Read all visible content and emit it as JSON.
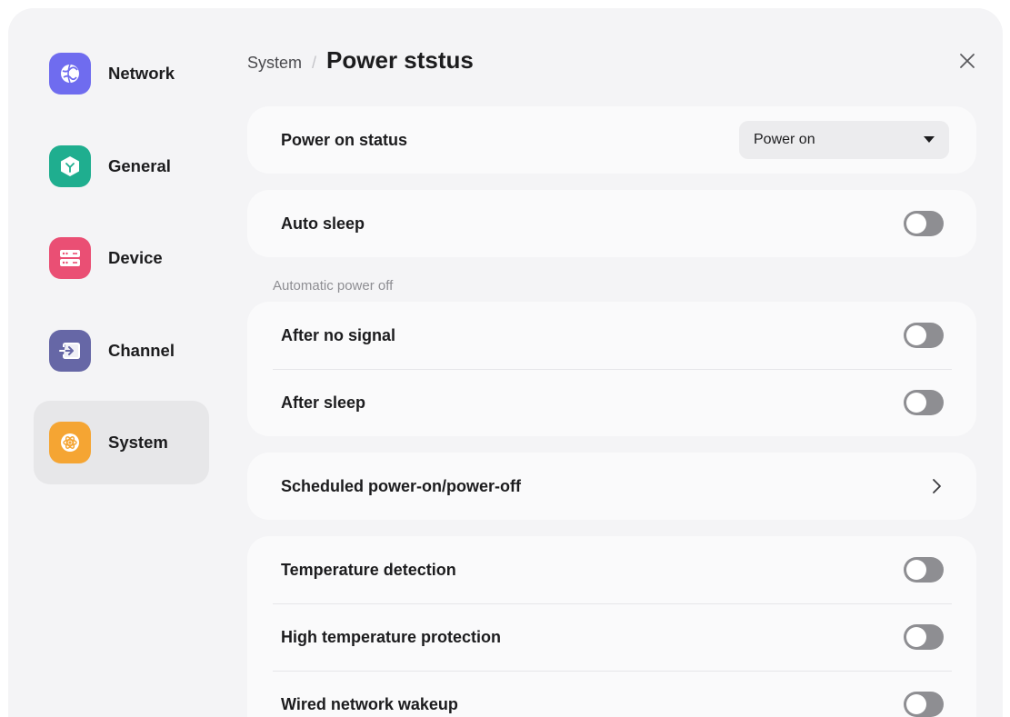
{
  "sidebar": {
    "items": [
      {
        "label": "Network",
        "icon": "globe-icon",
        "color": "#6f6cef"
      },
      {
        "label": "General",
        "icon": "cube-icon",
        "color": "#1fae8f"
      },
      {
        "label": "Device",
        "icon": "server-icon",
        "color": "#ea4f74"
      },
      {
        "label": "Channel",
        "icon": "input-icon",
        "color": "#6667a6"
      },
      {
        "label": "System",
        "icon": "atom-icon",
        "color": "#f5a533",
        "active": true
      }
    ]
  },
  "header": {
    "parent": "System",
    "separator": "/",
    "title": "Power ststus"
  },
  "power_on_status": {
    "label": "Power on status",
    "value": "Power on"
  },
  "auto_sleep": {
    "label": "Auto sleep",
    "on": false
  },
  "automatic_power_off": {
    "section_label": "Automatic power off",
    "after_no_signal": {
      "label": "After no signal",
      "on": false
    },
    "after_sleep": {
      "label": "After sleep",
      "on": false
    }
  },
  "scheduled": {
    "label": "Scheduled power-on/power-off"
  },
  "temperature": {
    "detection": {
      "label": "Temperature detection",
      "on": false
    },
    "protection": {
      "label": "High temperature protection",
      "on": false
    },
    "wired_wakeup": {
      "label": "Wired network wakeup",
      "on": false
    }
  }
}
